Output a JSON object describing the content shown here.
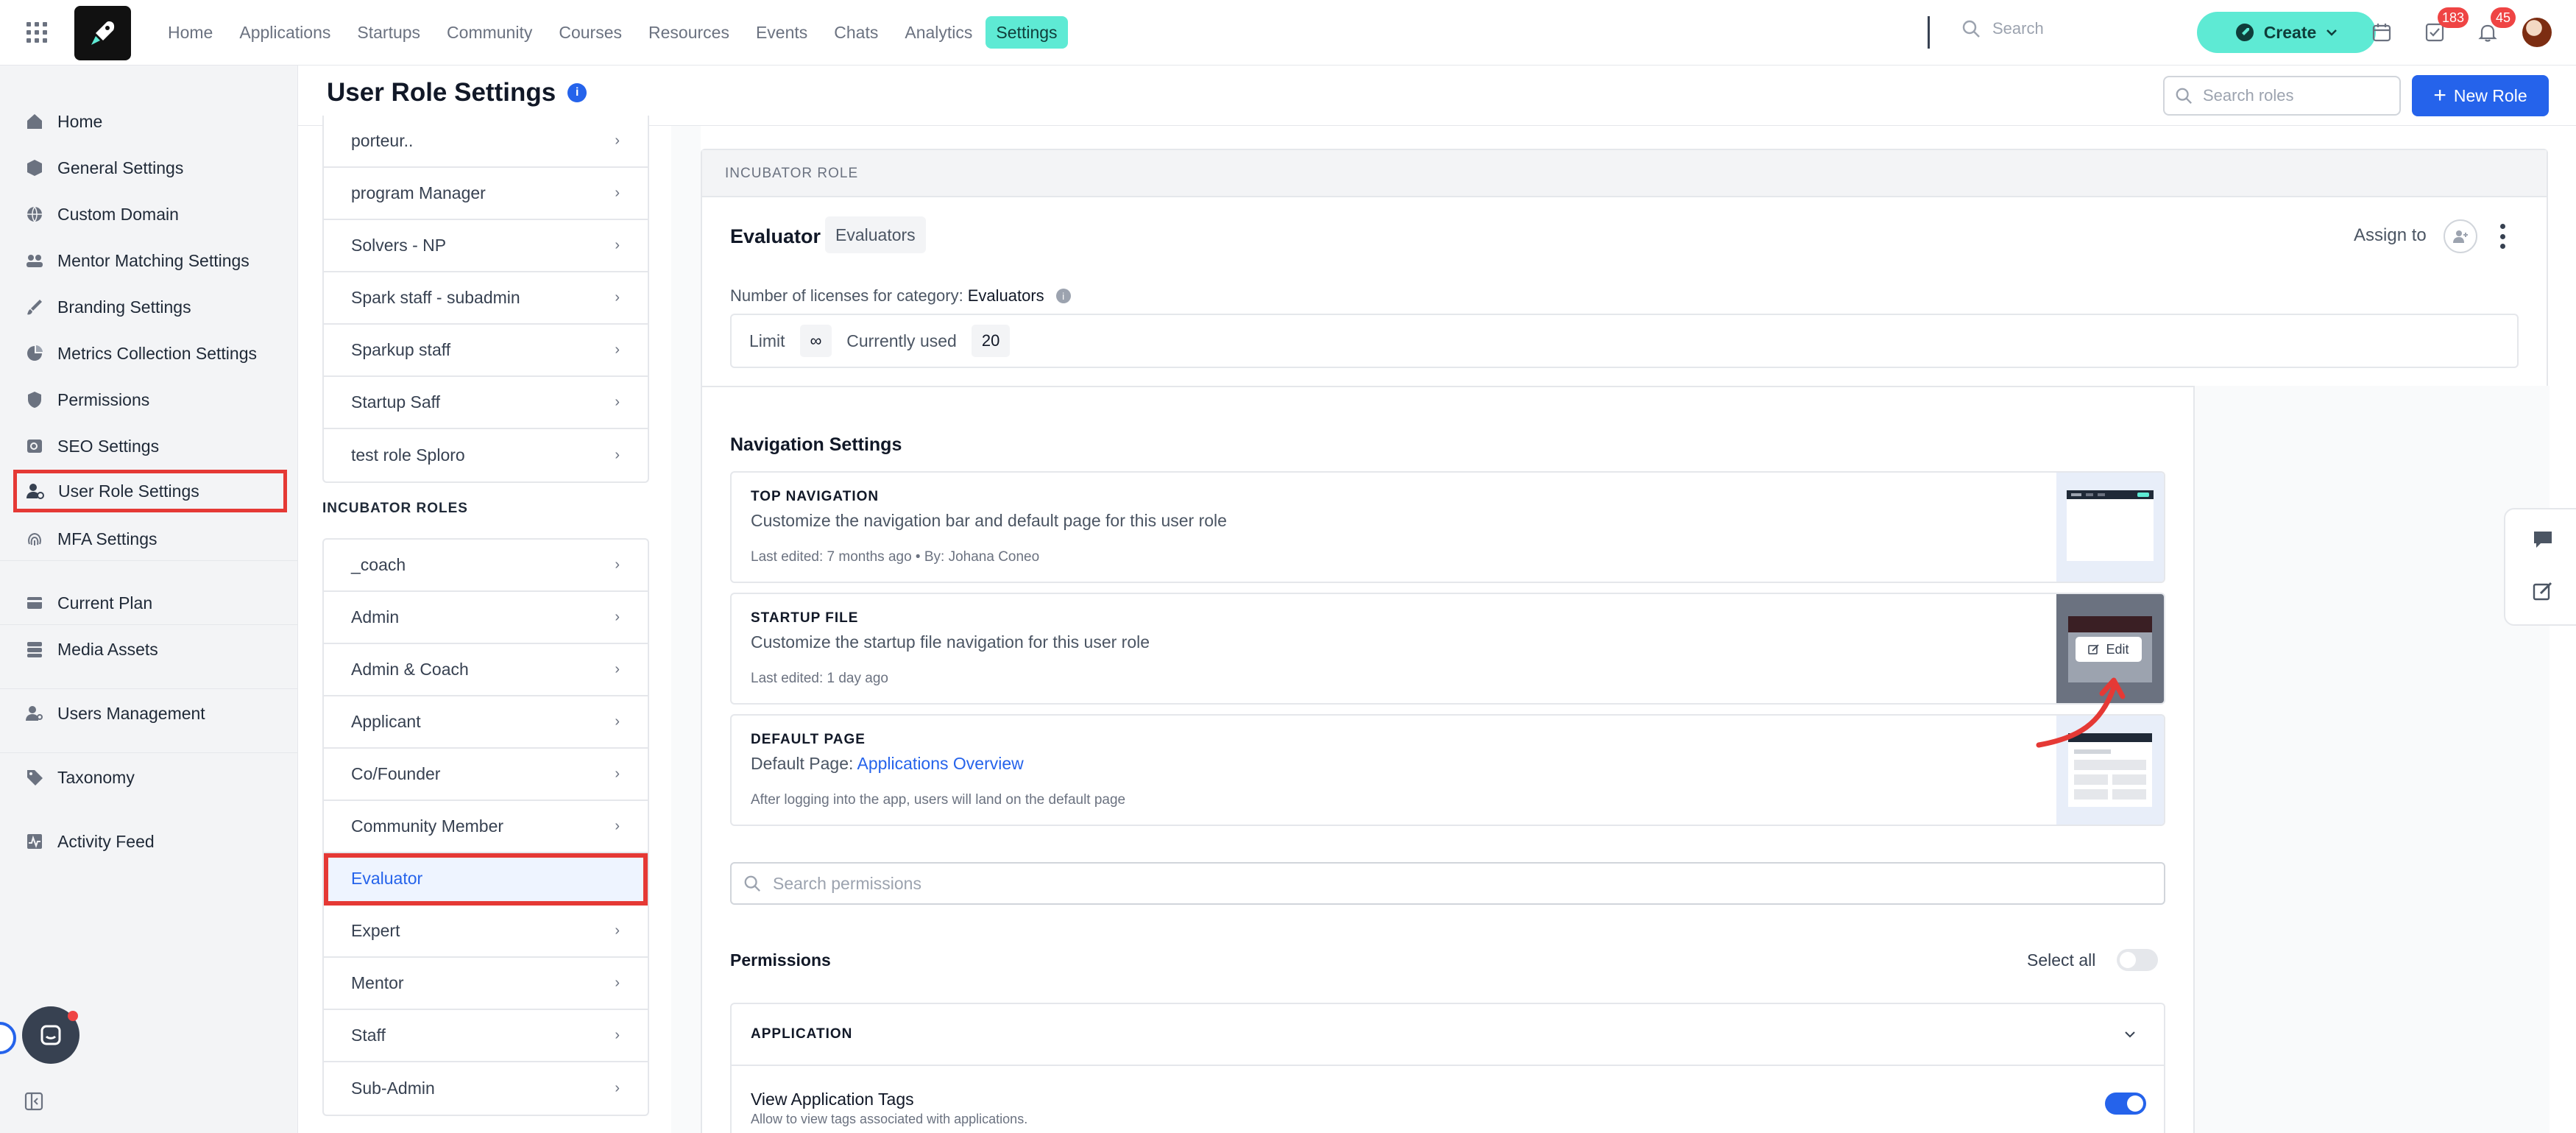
{
  "topnav": {
    "items": [
      {
        "label": "Home"
      },
      {
        "label": "Applications"
      },
      {
        "label": "Startups"
      },
      {
        "label": "Community"
      },
      {
        "label": "Courses"
      },
      {
        "label": "Resources"
      },
      {
        "label": "Events"
      },
      {
        "label": "Chats"
      },
      {
        "label": "Analytics"
      },
      {
        "label": "Settings",
        "active": true
      }
    ],
    "search_placeholder": "Search",
    "create_label": "Create",
    "tasks_badge": "183",
    "notifications_badge": "45"
  },
  "sidebar": {
    "items": [
      {
        "label": "Home",
        "icon": "home-icon"
      },
      {
        "label": "General Settings",
        "icon": "cube-icon"
      },
      {
        "label": "Custom Domain",
        "icon": "globe-icon"
      },
      {
        "label": "Mentor Matching Settings",
        "icon": "users-match-icon"
      },
      {
        "label": "Branding Settings",
        "icon": "brush-icon"
      },
      {
        "label": "Metrics Collection Settings",
        "icon": "pie-chart-icon"
      },
      {
        "label": "Permissions",
        "icon": "shield-icon"
      },
      {
        "label": "SEO Settings",
        "icon": "seo-icon"
      },
      {
        "label": "User Role Settings",
        "icon": "user-gear-icon",
        "selected": true
      },
      {
        "label": "MFA Settings",
        "icon": "fingerprint-icon"
      },
      {
        "label": "Current Plan",
        "icon": "card-icon"
      },
      {
        "label": "Media Assets",
        "icon": "database-icon"
      },
      {
        "label": "Users Management",
        "icon": "user-manage-icon"
      },
      {
        "label": "Taxonomy",
        "icon": "tag-icon"
      },
      {
        "label": "Activity Feed",
        "icon": "activity-icon"
      }
    ]
  },
  "header": {
    "title": "User Role Settings",
    "search_roles_placeholder": "Search roles",
    "new_role_label": "New Role"
  },
  "roles": {
    "top_group": [
      "porteur..",
      "program Manager",
      "Solvers - NP",
      "Spark staff - subadmin",
      "Sparkup staff",
      "Startup Saff",
      "test role Sploro"
    ],
    "incubator_label": "INCUBATOR ROLES",
    "incubator_group": [
      "_coach",
      "Admin",
      "Admin & Coach",
      "Applicant",
      "Co/Founder",
      "Community Member",
      "Evaluator",
      "Expert",
      "Mentor",
      "Staff",
      "Sub-Admin"
    ],
    "selected": "Evaluator"
  },
  "detail": {
    "section_label": "INCUBATOR ROLE",
    "role_name": "Evaluator",
    "role_category": "Evaluators",
    "assign_label": "Assign to",
    "licenses_label": "Number of licenses for category:",
    "licenses_category": "Evaluators",
    "limit_label": "Limit",
    "limit_value": "∞",
    "used_label": "Currently used",
    "used_value": "20",
    "nav_settings_title": "Navigation Settings",
    "cards": [
      {
        "key": "TOP NAVIGATION",
        "desc": "Customize the navigation bar and default page for this user role",
        "meta": "Last edited: 7 months ago • By: Johana Coneo"
      },
      {
        "key": "STARTUP FILE",
        "desc": "Customize the startup file navigation for this user role",
        "meta": "Last edited: 1 day ago",
        "edit_label": "Edit"
      },
      {
        "key": "DEFAULT PAGE",
        "desc_prefix": "Default Page:",
        "desc_link": "Applications Overview",
        "meta": "After logging into the app, users will land on the default page"
      }
    ],
    "search_permissions_placeholder": "Search permissions",
    "permissions_title": "Permissions",
    "select_all_label": "Select all",
    "select_all_on": false,
    "application_section": "APPLICATION",
    "permission_name": "View Application Tags",
    "permission_desc": "Allow to view tags associated with applications.",
    "permission_on": true
  },
  "colors": {
    "accent": "#2563eb",
    "brand_teal": "#5eead4",
    "highlight_red": "#e53935"
  }
}
